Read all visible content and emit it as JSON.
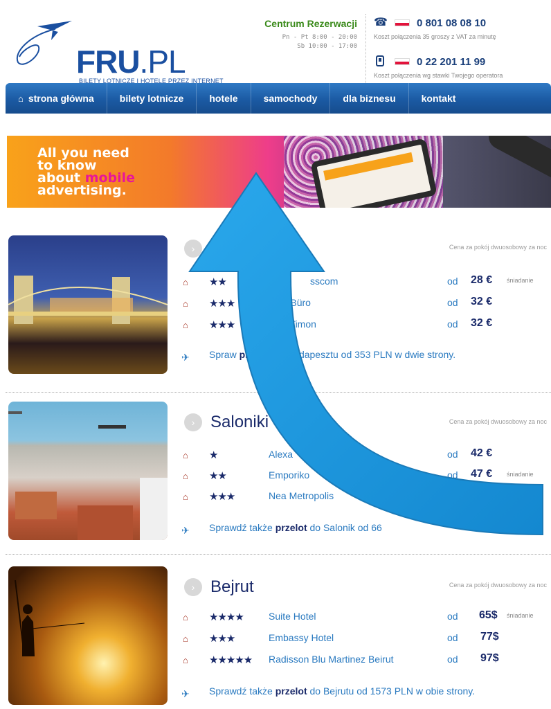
{
  "header": {
    "logo_main": "FRU",
    "logo_suffix": ".PL",
    "logo_tagline": "BILETY LOTNICZE I HOTELE PRZEZ INTERNET",
    "reservation_title": "Centrum Rezerwacji",
    "hours_weekday": "Pn - Pt 8:00 - 20:00",
    "hours_saturday": "Sb 10:00 - 17:00",
    "phone1_number": "0 801 08 08 10",
    "phone1_note": "Koszt połączenia 35 groszy z VAT za minutę",
    "phone2_number": "0 22 201 11 99",
    "phone2_note": "Koszt połączenia wg stawki Twojego operatora"
  },
  "nav": {
    "items": [
      {
        "label": "strona główna",
        "icon": "home-icon"
      },
      {
        "label": "bilety lotnicze"
      },
      {
        "label": "hotele"
      },
      {
        "label": "samochody"
      },
      {
        "label": "dla biznesu"
      },
      {
        "label": "kontakt"
      }
    ]
  },
  "banner": {
    "line1": "All you need",
    "line2": "to know",
    "line3_a": "about ",
    "line3_b": "mobile",
    "line4": "advertising."
  },
  "destinations": [
    {
      "city": "B",
      "price_note": "Cena za pokój dwuosobowy za noc",
      "hotels": [
        {
          "stars": "★★",
          "name": "sscom",
          "od": "od",
          "price": "28 €",
          "extra": "śniadanie"
        },
        {
          "stars": "★★★",
          "name": "nsion Büro",
          "od": "od",
          "price": "32 €",
          "extra": ""
        },
        {
          "stars": "★★★",
          "name": "el Timon",
          "od": "od",
          "price": "32 €",
          "extra": ""
        }
      ],
      "flight_a": "Spraw",
      "flight_b": "przelot",
      "flight_c": " do Budapesztu od 353 PLN w dwie strony."
    },
    {
      "city": "Saloniki",
      "price_note": "Cena za pokój dwuosobowy za noc",
      "hotels": [
        {
          "stars": "★",
          "name": "Alexa",
          "od": "od",
          "price": "42 €",
          "extra": ""
        },
        {
          "stars": "★★",
          "name": "Emporiko",
          "od": "od",
          "price": "47 €",
          "extra": "śniadanie"
        },
        {
          "stars": "★★★",
          "name": "Nea Metropolis",
          "od": "",
          "price": "",
          "extra": ""
        }
      ],
      "flight_a": "Sprawdź także ",
      "flight_b": "przelot",
      "flight_c": " do Salonik od 66"
    },
    {
      "city": "Bejrut",
      "price_note": "Cena za pokój dwuosobowy za noc",
      "hotels": [
        {
          "stars": "★★★★",
          "name": "Suite Hotel",
          "od": "od",
          "price": "65$",
          "extra": "śniadanie"
        },
        {
          "stars": "★★★",
          "name": "Embassy Hotel",
          "od": "od",
          "price": "77$",
          "extra": ""
        },
        {
          "stars": "★★★★★",
          "name": "Radisson Blu Martinez Beirut",
          "od": "od",
          "price": "97$",
          "extra": ""
        }
      ],
      "flight_a": "Sprawdź także ",
      "flight_b": "przelot",
      "flight_c": " do Bejrutu od 1573 PLN w obie strony."
    }
  ],
  "colors": {
    "brand_blue": "#1a4fa0",
    "nav_blue": "#1b5aa3",
    "link_blue": "#2a7ac0",
    "green": "#3a8a1a",
    "arrow_blue": "#1a9ae0"
  }
}
